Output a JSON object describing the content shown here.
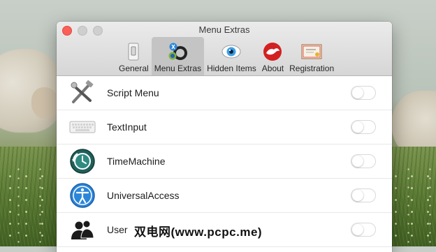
{
  "window": {
    "title": "Menu Extras"
  },
  "toolbar": {
    "tabs": [
      {
        "label": "General",
        "icon": "switch-icon",
        "active": false
      },
      {
        "label": "Menu Extras",
        "icon": "menu-extras-icon",
        "active": true
      },
      {
        "label": "Hidden Items",
        "icon": "eye-icon",
        "active": false
      },
      {
        "label": "About",
        "icon": "hand-logo-icon",
        "active": false
      },
      {
        "label": "Registration",
        "icon": "license-certificate-icon",
        "active": false
      }
    ]
  },
  "rows": [
    {
      "label": "Script Menu",
      "icon": "script-menu-icon",
      "enabled": false
    },
    {
      "label": "TextInput",
      "icon": "keyboard-icon",
      "enabled": false
    },
    {
      "label": "TimeMachine",
      "icon": "time-machine-icon",
      "enabled": false
    },
    {
      "label": "UniversalAccess",
      "icon": "accessibility-icon",
      "enabled": false
    },
    {
      "label": "User",
      "icon": "users-icon",
      "enabled": false
    }
  ],
  "watermark": "双电网(www.pcpc.me)",
  "colors": {
    "close": "#fc5f57",
    "toolbar_active": "#c4c4c4",
    "accent_blue": "#2b86d9"
  }
}
